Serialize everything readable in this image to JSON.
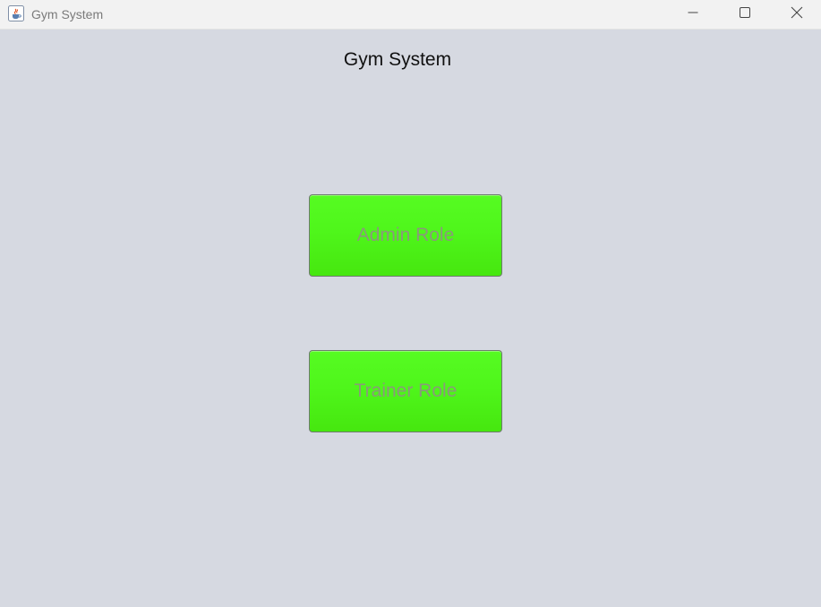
{
  "window": {
    "title": "Gym System"
  },
  "main": {
    "heading": "Gym System",
    "buttons": {
      "admin_label": "Admin Role",
      "trainer_label": "Trainer Role"
    }
  },
  "icons": {
    "app": "java-coffee-cup-icon",
    "minimize": "minimize-icon",
    "maximize": "maximize-icon",
    "close": "close-icon"
  },
  "colors": {
    "background": "#d6d9e1",
    "titlebar": "#f2f2f2",
    "button_fill": "#4ff61b",
    "button_text": "#8a9a7a"
  }
}
